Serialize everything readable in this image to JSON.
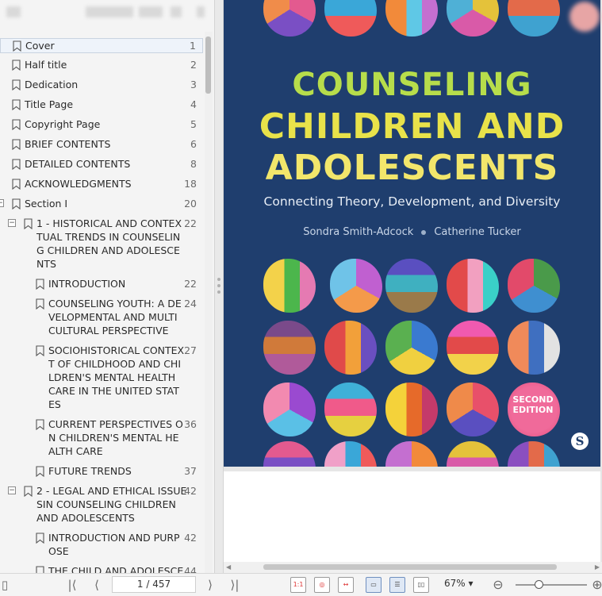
{
  "sidebar": {
    "bookmarks": [
      {
        "label": "Cover",
        "page": "1"
      },
      {
        "label": "Half title",
        "page": "2"
      },
      {
        "label": "Dedication",
        "page": "3"
      },
      {
        "label": "Title Page",
        "page": "4"
      },
      {
        "label": "Copyright Page",
        "page": "5"
      },
      {
        "label": "BRIEF CONTENTS",
        "page": "6"
      },
      {
        "label": "DETAILED CONTENTS",
        "page": "8"
      },
      {
        "label": "ACKNOWLEDGMENTS",
        "page": "18"
      },
      {
        "label": "Section I",
        "page": "20"
      },
      {
        "label": "1 - HISTORICAL AND CONTEX\nTUAL TRENDS IN COUNSELIN\nG CHILDREN AND ADOLESCE\nNTS",
        "page": "22"
      },
      {
        "label": "INTRODUCTION",
        "page": "22"
      },
      {
        "label": "COUNSELING YOUTH: A DE\nVELOPMENTAL AND MULTI\nCULTURAL PERSPECTIVE",
        "page": "24"
      },
      {
        "label": "SOCIOHISTORICAL CONTEX\nT OF CHILDHOOD AND CHI\nLDREN'S MENTAL HEALTH\nCARE IN THE UNITED STAT\nES",
        "page": "27"
      },
      {
        "label": "CURRENT PERSPECTIVES O\nN CHILDREN'S MENTAL HE\nALTH CARE",
        "page": "36"
      },
      {
        "label": "FUTURE TRENDS",
        "page": "37"
      },
      {
        "label": "2 - LEGAL AND ETHICAL ISSUE\nSIN COUNSELING CHILDREN\nAND ADOLESCENTS",
        "page": "42"
      },
      {
        "label": "INTRODUCTION AND PURP\nOSE",
        "page": "42"
      },
      {
        "label": "THE CHILD AND ADOLESCE",
        "page": "44"
      }
    ],
    "toggle_collapsed": "−"
  },
  "cover": {
    "title_line1": "COUNSELING",
    "title_line2": "CHILDREN AND",
    "title_line3": "ADOLESCENTS",
    "subtitle": "Connecting Theory, Development, and Diversity",
    "author1": "Sondra Smith-Adcock",
    "author2": "Catherine Tucker",
    "edition_line1": "SECOND",
    "edition_line2": "EDITION",
    "publisher_mark": "S",
    "background_color": "#1f3e6e"
  },
  "toolbar": {
    "first_page_icon": "first-page-icon",
    "prev_page_icon": "prev-page-icon",
    "page_indicator": "1 / 457",
    "next_page_icon": "next-page-icon",
    "last_page_icon": "last-page-icon",
    "zoom": "67%",
    "zoom_out": "−",
    "zoom_in": "+"
  }
}
